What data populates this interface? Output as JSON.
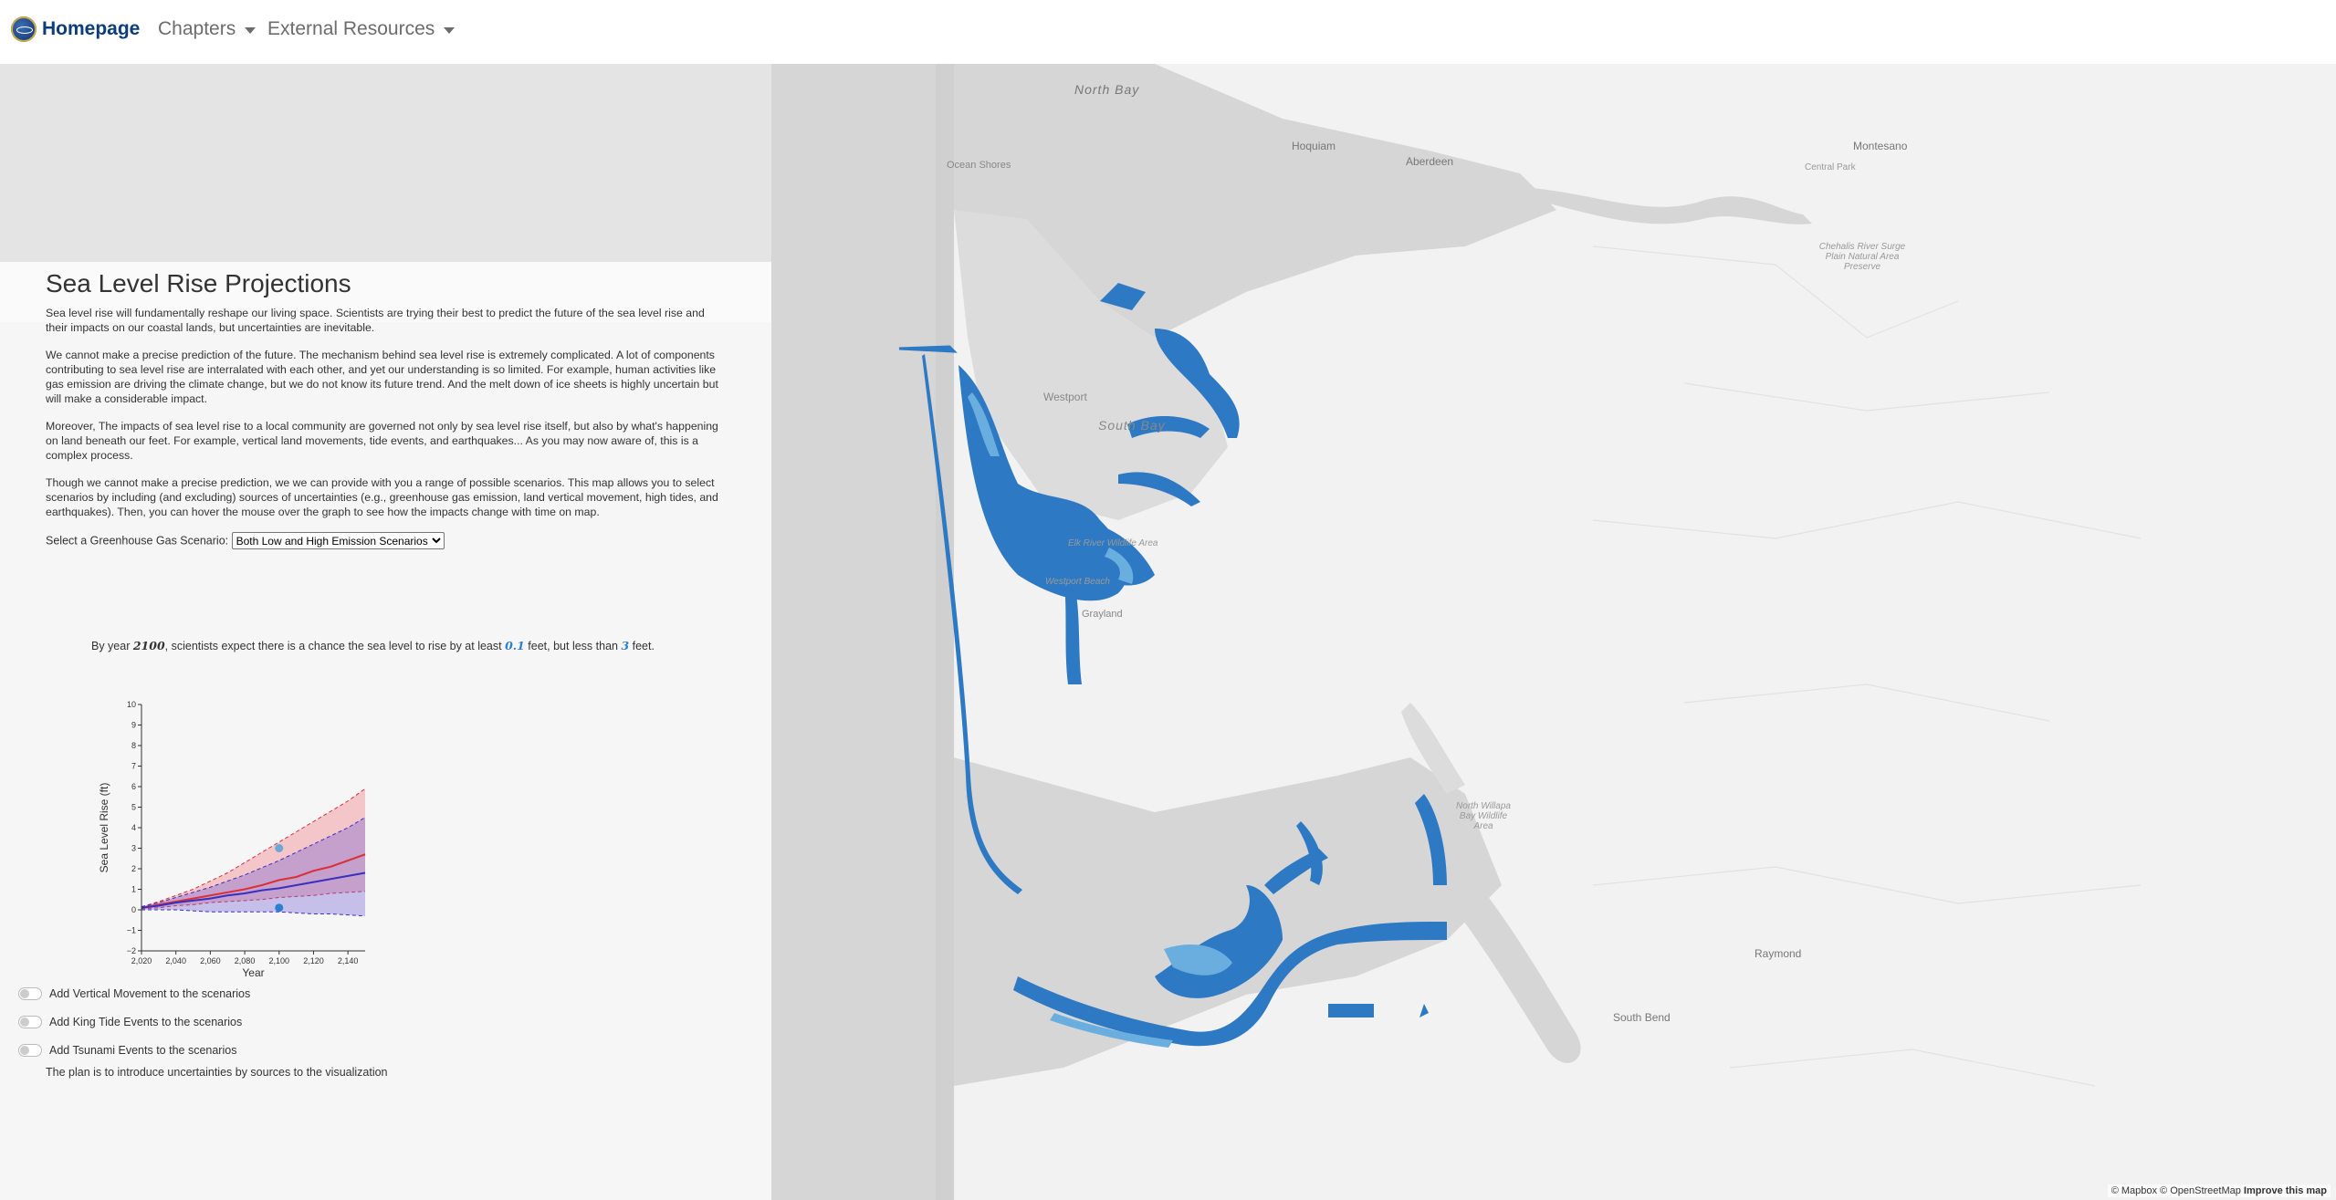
{
  "nav": {
    "brand": "Homepage",
    "items": [
      {
        "label": "Chapters"
      },
      {
        "label": "External Resources"
      }
    ]
  },
  "main": {
    "title": "Sea Level Rise Projections",
    "paragraphs": [
      "Sea level rise will fundamentally reshape our living space. Scientists are trying their best to predict the future of the sea level rise and their impacts on our coastal lands, but uncertainties are inevitable.",
      "We cannot make a precise prediction of the future. The mechanism behind sea level rise is extremely complicated. A lot of components contributing to sea level rise are interralated with each other, and yet our understanding is so limited. For example, human activities like gas emission are driving the climate change, but we do not know its future trend. And the melt down of ice sheets is highly uncertain but will make a considerable impact.",
      "Moreover, The impacts of sea level rise to a local community are governed not only by sea level rise itself, but also by what's happening on land beneath our feet. For example, vertical land movements, tide events, and earthquakes... As you may now aware of, this is a complex process.",
      "Though we cannot make a precise prediction, we we can provide with you a range of possible scenarios. This map allows you to select scenarios by including (and excluding) sources of uncertainties (e.g., greenhouse gas emission, land vertical movement, high tides, and earthquakes). Then, you can hover the mouse over the graph to see how the impacts change with time on map."
    ],
    "select_label": "Select a Greenhouse Gas Scenario:",
    "select_value": "Both Low and High Emission Scenarios",
    "projection": {
      "prefix": "By year ",
      "year": "2100",
      "mid1": ", scientists expect there is a chance the sea level to rise by at least ",
      "low": "0.1",
      "mid2": " feet, but less than ",
      "high": "3",
      "suffix": " feet."
    },
    "toggles": [
      {
        "label": "Add Vertical Movement to the scenarios"
      },
      {
        "label": "Add King Tide Events to the scenarios"
      },
      {
        "label": "Add Tsunami Events to the scenarios"
      }
    ],
    "plan_note": "The plan is to introduce uncertainties by sources to the visualization"
  },
  "chart_data": {
    "type": "area",
    "xlabel": "Year",
    "ylabel": "Sea Level Rise (ft)",
    "xlim": [
      2020,
      2150
    ],
    "ylim": [
      -2,
      10
    ],
    "x_ticks": [
      "2,020",
      "2,040",
      "2,060",
      "2,080",
      "2,100",
      "2,120",
      "2,140"
    ],
    "y_ticks": [
      "−2",
      "−1",
      "0",
      "1",
      "2",
      "3",
      "4",
      "5",
      "6",
      "7",
      "8",
      "9",
      "10"
    ],
    "x": [
      2020,
      2030,
      2040,
      2050,
      2060,
      2070,
      2080,
      2090,
      2100,
      2110,
      2120,
      2130,
      2140,
      2150
    ],
    "series": [
      {
        "color": "#d9303a",
        "median": [
          0.1,
          0.25,
          0.4,
          0.55,
          0.7,
          0.85,
          1.0,
          1.2,
          1.45,
          1.6,
          1.9,
          2.1,
          2.4,
          2.7
        ],
        "upper": [
          0.15,
          0.4,
          0.7,
          1.0,
          1.4,
          1.8,
          2.3,
          2.8,
          3.3,
          3.8,
          4.3,
          4.8,
          5.3,
          5.9
        ],
        "lower": [
          0.05,
          0.1,
          0.2,
          0.25,
          0.35,
          0.4,
          0.45,
          0.5,
          0.6,
          0.65,
          0.7,
          0.8,
          0.85,
          0.9
        ]
      },
      {
        "color": "#3a2fbf",
        "median": [
          0.1,
          0.2,
          0.35,
          0.45,
          0.55,
          0.7,
          0.8,
          0.95,
          1.05,
          1.2,
          1.35,
          1.5,
          1.65,
          1.8
        ],
        "upper": [
          0.15,
          0.35,
          0.6,
          0.85,
          1.1,
          1.4,
          1.7,
          2.05,
          2.4,
          2.8,
          3.2,
          3.6,
          4.0,
          4.5
        ],
        "lower": [
          0.0,
          0.0,
          0.0,
          -0.05,
          -0.1,
          -0.1,
          -0.1,
          -0.1,
          -0.1,
          -0.15,
          -0.2,
          -0.2,
          -0.25,
          -0.3
        ]
      }
    ],
    "markers": [
      {
        "x": 2100,
        "y": 3.0,
        "color": "#6aa8d8"
      },
      {
        "x": 2100,
        "y": 0.1,
        "color": "#2a7fd4"
      }
    ]
  },
  "map": {
    "labels": [
      "North Bay",
      "Ocean Shores",
      "Hoquiam",
      "Aberdeen",
      "Montesano",
      "Central Park",
      "Chehalis River Surge Plain Natural Area Preserve",
      "Westport",
      "South Bay",
      "Elk River Wildlife Area",
      "Westport Beach",
      "Grayland",
      "North Willapa Bay Wildlife Area",
      "Raymond",
      "South Bend"
    ],
    "attribution_1": "© Mapbox © OpenStreetMap",
    "attribution_2": "Improve this map",
    "flood_color": "#2e79c4",
    "flood_light": "#6aaee0"
  }
}
